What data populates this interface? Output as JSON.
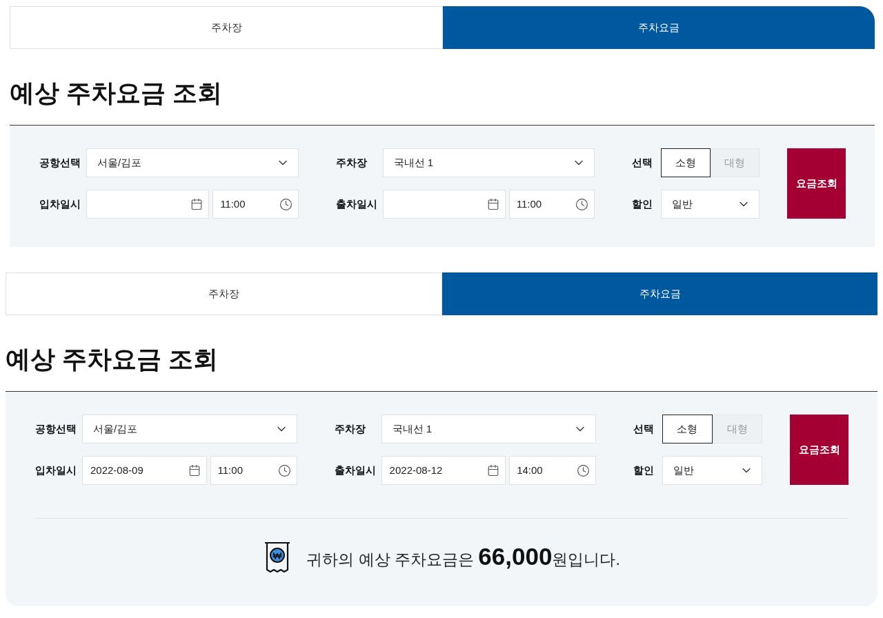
{
  "panels": [
    {
      "tabs": [
        {
          "label": "주차장",
          "selected": false
        },
        {
          "label": "주차요금",
          "selected": true
        }
      ],
      "title": "예상 주차요금 조회",
      "fields": [
        {
          "kind": "select",
          "label": "공항선택",
          "value": "서울/김포"
        },
        {
          "kind": "select",
          "label": "주차장",
          "value": "국내선 1"
        },
        {
          "kind": "toggle",
          "label": "선택",
          "options": [
            {
              "label": "소형",
              "selected": true
            },
            {
              "label": "대형",
              "selected": false
            }
          ]
        },
        {
          "kind": "datetime",
          "label": "입차일시",
          "time": "11:00"
        },
        {
          "kind": "datetime",
          "label": "출차일시",
          "time": "11:00"
        },
        {
          "kind": "select",
          "label": "할인",
          "value": "일반"
        }
      ],
      "search_button": "요금조회"
    },
    {
      "tabs": [
        {
          "label": "주차장",
          "selected": false
        },
        {
          "label": "주차요금",
          "selected": true
        }
      ],
      "title": "예상 주차요금 조회",
      "fields": [
        {
          "kind": "select",
          "label": "공항선택",
          "value": "서울/김포"
        },
        {
          "kind": "select",
          "label": "주차장",
          "value": "국내선 1"
        },
        {
          "kind": "toggle",
          "label": "선택",
          "options": [
            {
              "label": "소형",
              "selected": true
            },
            {
              "label": "대형",
              "selected": false
            }
          ]
        },
        {
          "kind": "datetime",
          "label": "입차일시",
          "date": "2022-08-09",
          "time": "11:00"
        },
        {
          "kind": "datetime",
          "label": "출차일시",
          "date": "2022-08-12",
          "time": "14:00"
        },
        {
          "kind": "select",
          "label": "할인",
          "value": "일반"
        }
      ],
      "search_button": "요금조회",
      "result": {
        "text": "귀하의 예상 주차요금은 **66,000**원입니다."
      }
    }
  ]
}
